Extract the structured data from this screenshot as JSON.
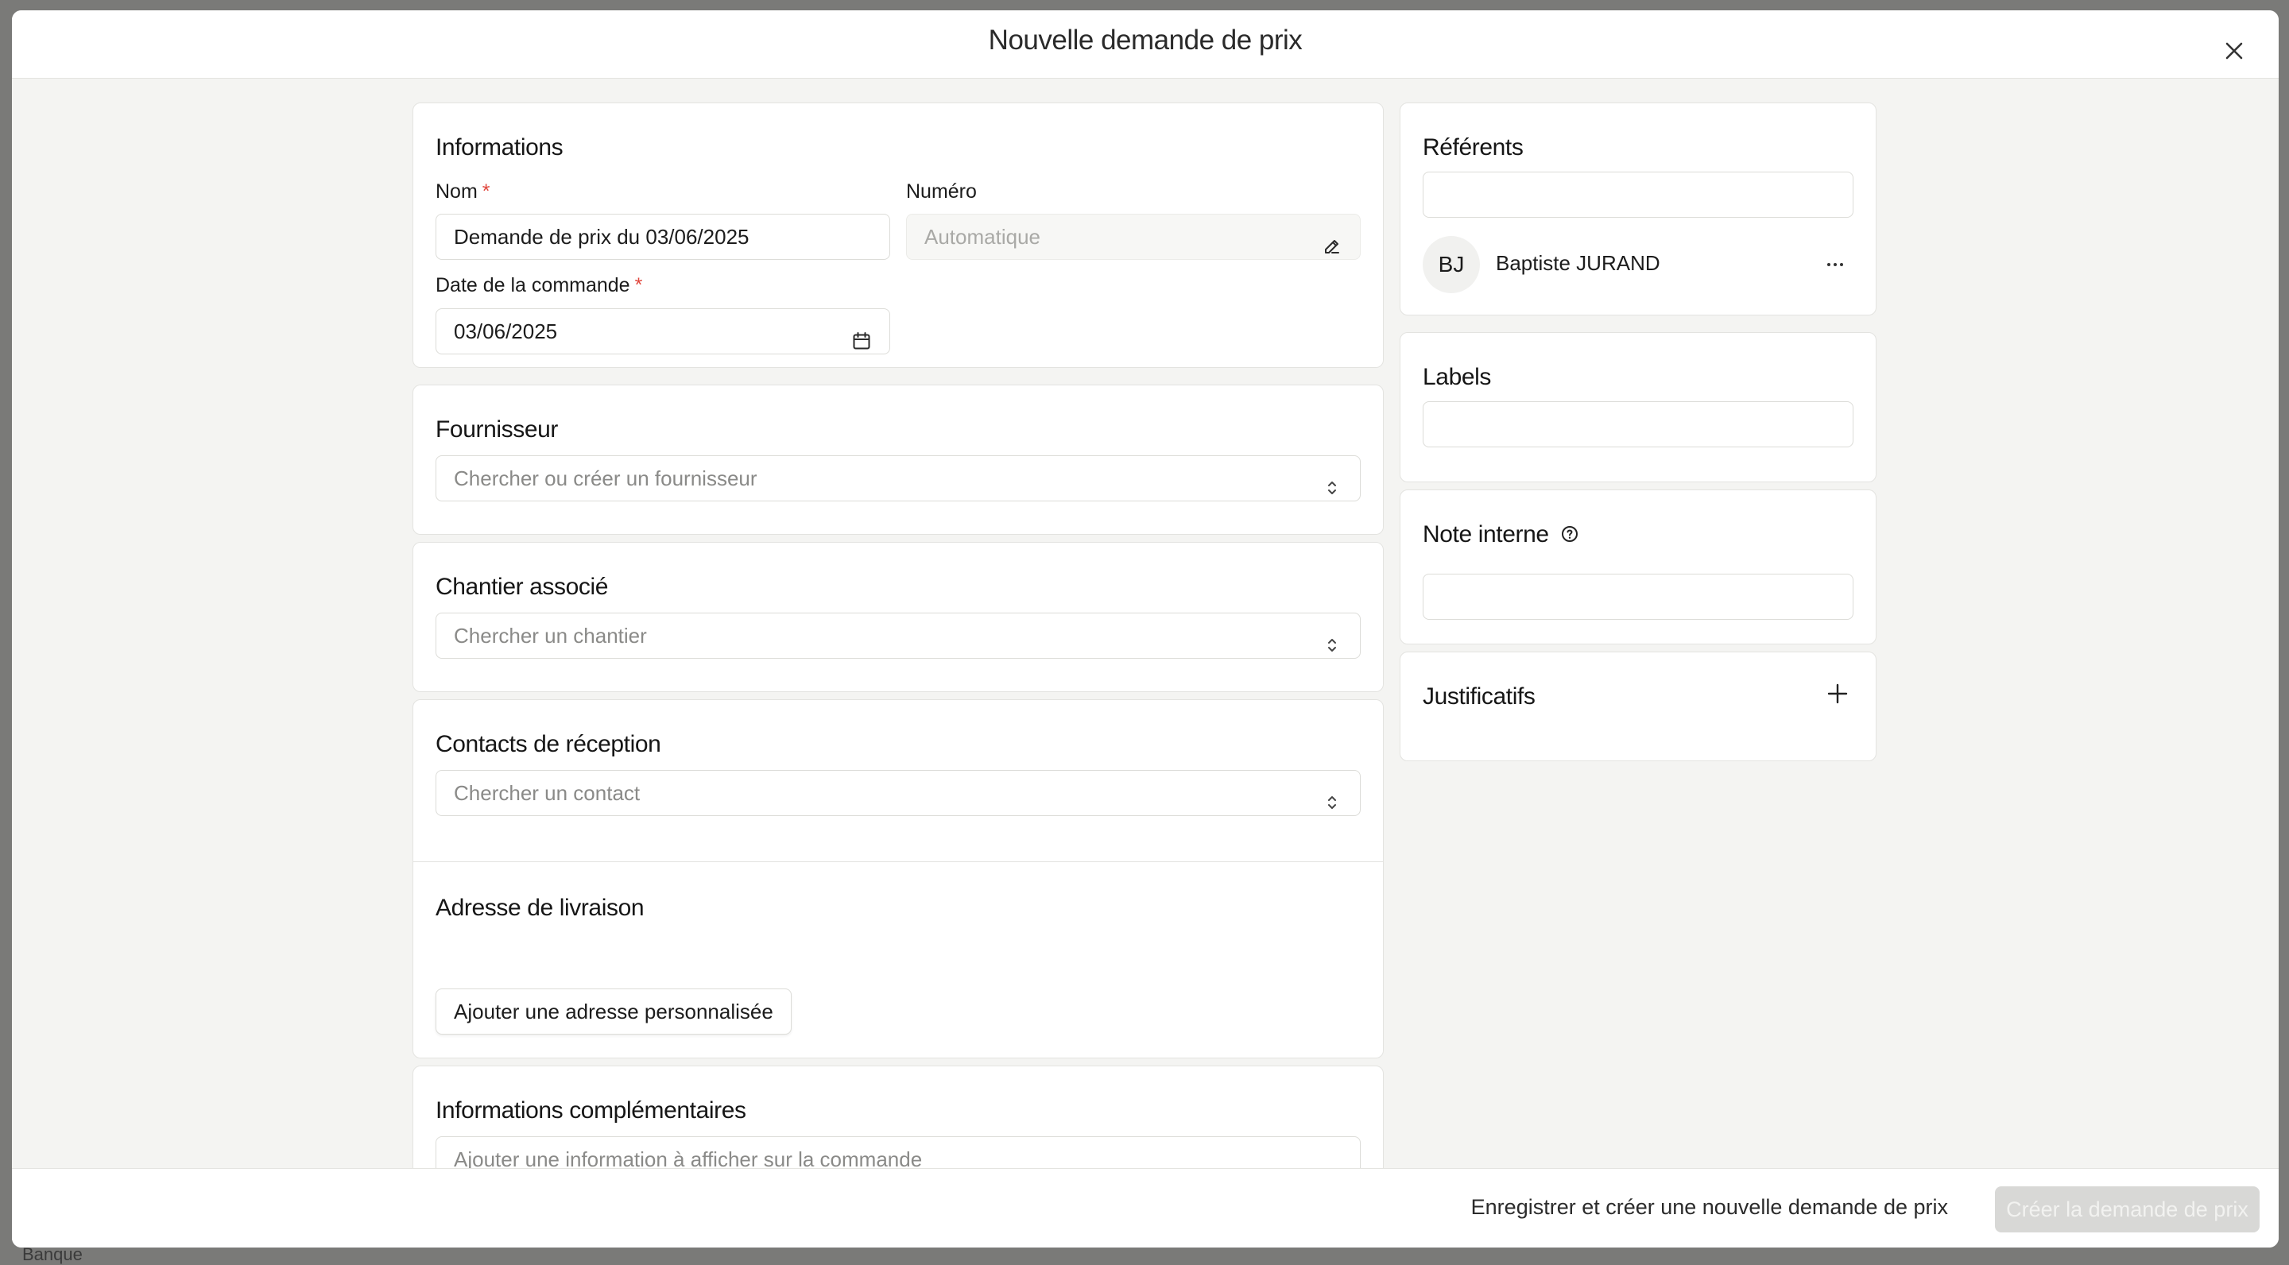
{
  "backdrop": {
    "text": "Banque"
  },
  "modal": {
    "title": "Nouvelle demande de prix",
    "close_icon": "close-icon"
  },
  "informations": {
    "title": "Informations",
    "nom_label": "Nom",
    "nom_value": "Demande de prix du 03/06/2025",
    "numero_label": "Numéro",
    "numero_placeholder": "Automatique",
    "date_label": "Date de la commande",
    "date_value": "03/06/2025",
    "required_mark": "*"
  },
  "fournisseur": {
    "title": "Fournisseur",
    "placeholder": "Chercher ou créer un fournisseur"
  },
  "chantier": {
    "title": "Chantier associé",
    "placeholder": "Chercher un chantier"
  },
  "contacts": {
    "title": "Contacts de réception",
    "placeholder": "Chercher un contact"
  },
  "adresse": {
    "title": "Adresse de livraison",
    "button_label": "Ajouter une adresse personnalisée"
  },
  "complementaires": {
    "title": "Informations complémentaires",
    "placeholder": "Ajouter une information à afficher sur la commande"
  },
  "referents": {
    "title": "Référents",
    "search_value": "",
    "user": {
      "initials": "BJ",
      "name": "Baptiste JURAND",
      "menu_icon": "more-horizontal-icon"
    }
  },
  "labels": {
    "title": "Labels",
    "value": ""
  },
  "note": {
    "title": "Note interne",
    "value": "",
    "help_icon": "help-circle-icon"
  },
  "justificatifs": {
    "title": "Justificatifs",
    "add_icon": "plus-icon"
  },
  "footer": {
    "secondary_label": "Enregistrer et créer une nouvelle demande de prix",
    "primary_label": "Créer la demande de prix"
  },
  "colors": {
    "modal_bg": "#f4f4f2",
    "card_bg": "#ffffff",
    "required": "#e0463c",
    "primary_disabled_bg": "#d8d8d6"
  }
}
